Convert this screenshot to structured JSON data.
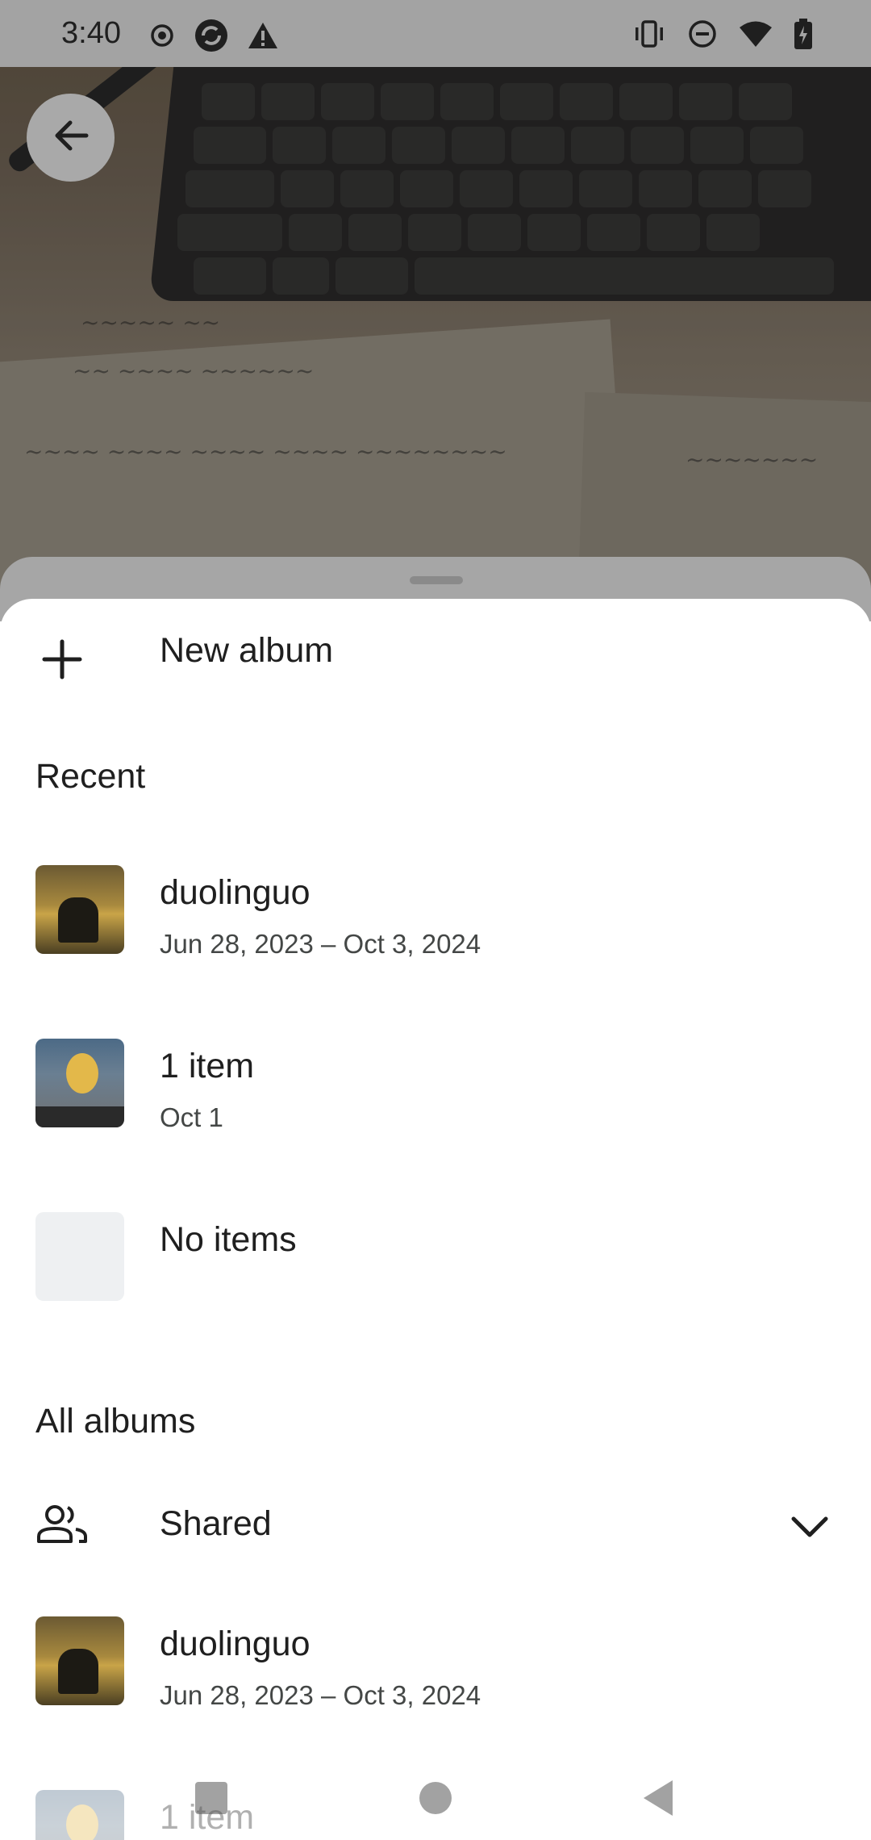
{
  "status_bar": {
    "time": "3:40",
    "left_icons": [
      "record-icon",
      "sync-icon",
      "warning-icon"
    ],
    "right_icons": [
      "vibrate-icon",
      "do-not-disturb-icon",
      "wifi-icon",
      "battery-charging-icon"
    ]
  },
  "background": {
    "back_icon": "arrow-back-icon"
  },
  "sheet": {
    "new_album": {
      "icon": "plus-icon",
      "label": "New album"
    },
    "recent": {
      "title": "Recent",
      "items": [
        {
          "title": "duolinguo",
          "subtitle": "Jun 28, 2023 – Oct 3, 2024",
          "thumb": "sunset"
        },
        {
          "title": "1 item",
          "subtitle": "Oct 1",
          "thumb": "toy"
        },
        {
          "title": "No items",
          "subtitle": "",
          "thumb": "empty"
        }
      ]
    },
    "all_albums": {
      "title": "All albums",
      "shared": {
        "icon": "people-icon",
        "label": "Shared",
        "chevron": "chevron-down-icon"
      },
      "items": [
        {
          "title": "duolinguo",
          "subtitle": "Jun 28, 2023 – Oct 3, 2024",
          "thumb": "sunset"
        },
        {
          "title": "1 item",
          "subtitle": "",
          "thumb": "toy"
        }
      ]
    }
  },
  "nav_bar": {
    "buttons": [
      "recents-square-icon",
      "home-circle-icon",
      "back-triangle-icon"
    ]
  },
  "colors": {
    "scrim": "#a3a3a3",
    "text_primary": "#1f1f1f",
    "text_secondary": "#444746",
    "sheet_bg": "#ffffff"
  }
}
